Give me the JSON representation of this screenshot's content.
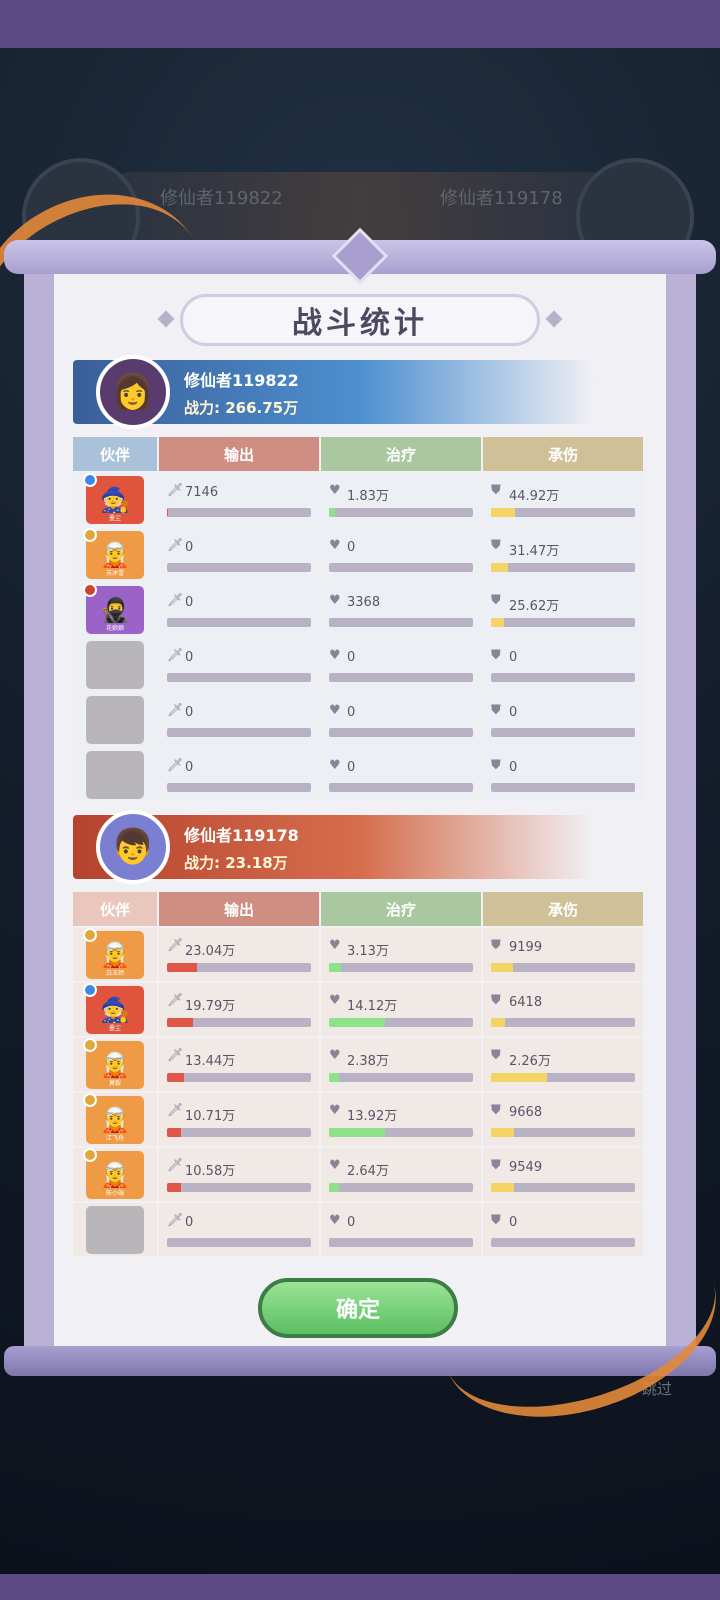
{
  "background": {
    "left_player_name": "修仙者119822",
    "right_player_name": "修仙者119178",
    "skip_label": "跳过"
  },
  "title": "战斗统计",
  "columns": {
    "partner": "伙伴",
    "output": "输出",
    "heal": "治疗",
    "taken": "承伤"
  },
  "ally": {
    "name": "修仙者119822",
    "power": "战力: 266.75万",
    "rows": [
      {
        "hero": "red",
        "caption": "墨尘",
        "output": "7146",
        "output_fill": 0.01,
        "heal": "1.83万",
        "heal_fill": 0.04,
        "taken": "44.92万",
        "taken_fill": 0.17
      },
      {
        "hero": "orange",
        "caption": "苏沐雪",
        "output": "0",
        "output_fill": 0,
        "heal": "0",
        "heal_fill": 0,
        "taken": "31.47万",
        "taken_fill": 0.12
      },
      {
        "hero": "purple",
        "caption": "花娘娘",
        "output": "0",
        "output_fill": 0,
        "heal": "3368",
        "heal_fill": 0,
        "taken": "25.62万",
        "taken_fill": 0.09
      },
      {
        "hero": "empty",
        "caption": "",
        "output": "0",
        "output_fill": 0,
        "heal": "0",
        "heal_fill": 0,
        "taken": "0",
        "taken_fill": 0
      },
      {
        "hero": "empty",
        "caption": "",
        "output": "0",
        "output_fill": 0,
        "heal": "0",
        "heal_fill": 0,
        "taken": "0",
        "taken_fill": 0
      },
      {
        "hero": "empty",
        "caption": "",
        "output": "0",
        "output_fill": 0,
        "heal": "0",
        "heal_fill": 0,
        "taken": "0",
        "taken_fill": 0
      }
    ]
  },
  "enemy": {
    "name": "修仙者119178",
    "power": "战力: 23.18万",
    "rows": [
      {
        "hero": "orange",
        "caption": "白玉师",
        "output": "23.04万",
        "output_fill": 0.21,
        "heal": "3.13万",
        "heal_fill": 0.08,
        "taken": "9199",
        "taken_fill": 0.15
      },
      {
        "hero": "red",
        "caption": "墨尘",
        "output": "19.79万",
        "output_fill": 0.18,
        "heal": "14.12万",
        "heal_fill": 0.39,
        "taken": "6418",
        "taken_fill": 0.1
      },
      {
        "hero": "orange",
        "caption": "莫毅",
        "output": "13.44万",
        "output_fill": 0.12,
        "heal": "2.38万",
        "heal_fill": 0.07,
        "taken": "2.26万",
        "taken_fill": 0.39
      },
      {
        "hero": "orange",
        "caption": "江飞舟",
        "output": "10.71万",
        "output_fill": 0.1,
        "heal": "13.92万",
        "heal_fill": 0.39,
        "taken": "9668",
        "taken_fill": 0.16
      },
      {
        "hero": "orange",
        "caption": "陈小端",
        "output": "10.58万",
        "output_fill": 0.1,
        "heal": "2.64万",
        "heal_fill": 0.07,
        "taken": "9549",
        "taken_fill": 0.16
      },
      {
        "hero": "empty",
        "caption": "",
        "output": "0",
        "output_fill": 0,
        "heal": "0",
        "heal_fill": 0,
        "taken": "0",
        "taken_fill": 0
      }
    ]
  },
  "confirm_label": "确定",
  "colors": {
    "output": "#e0574a",
    "heal": "#8ee28a",
    "taken": "#f5d466",
    "confirm": "#5cbf62"
  }
}
